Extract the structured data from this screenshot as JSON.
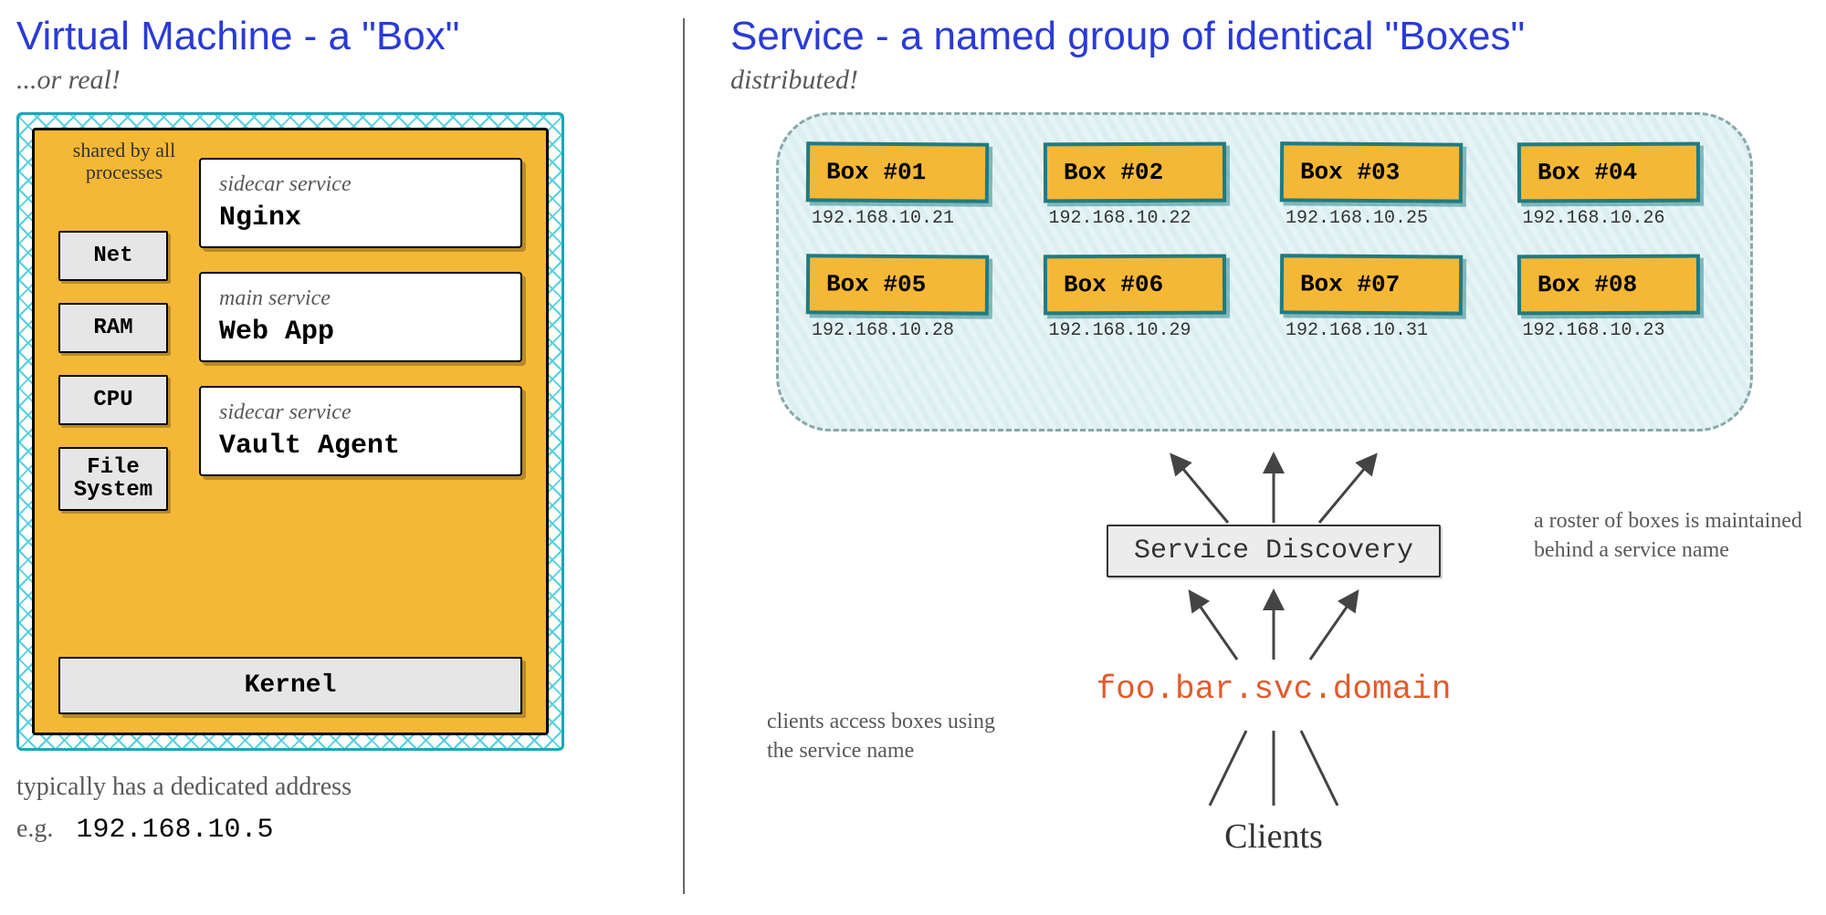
{
  "left": {
    "title": "Virtual Machine - a \"Box\"",
    "subtitle": "...or real!",
    "shared_label": "shared by all processes",
    "resources": [
      "Net",
      "RAM",
      "CPU",
      "File System"
    ],
    "services": [
      {
        "tag": "sidecar service",
        "name": "Nginx"
      },
      {
        "tag": "main service",
        "name": "Web App"
      },
      {
        "tag": "sidecar service",
        "name": "Vault Agent"
      }
    ],
    "kernel": "Kernel",
    "note": "typically has a dedicated address",
    "ip_label": "e.g.",
    "ip": "192.168.10.5"
  },
  "right": {
    "title": "Service - a named group of identical \"Boxes\"",
    "subtitle": "distributed!",
    "boxes": [
      {
        "label": "Box #01",
        "ip": "192.168.10.21"
      },
      {
        "label": "Box #02",
        "ip": "192.168.10.22"
      },
      {
        "label": "Box #03",
        "ip": "192.168.10.25"
      },
      {
        "label": "Box #04",
        "ip": "192.168.10.26"
      },
      {
        "label": "Box #05",
        "ip": "192.168.10.28"
      },
      {
        "label": "Box #06",
        "ip": "192.168.10.29"
      },
      {
        "label": "Box #07",
        "ip": "192.168.10.31"
      },
      {
        "label": "Box #08",
        "ip": "192.168.10.23"
      }
    ],
    "service_discovery": "Service Discovery",
    "svc_name": "foo.bar.svc.domain",
    "clients": "Clients",
    "roster_note": "a roster of boxes is maintained behind a service name",
    "client_note": "clients access boxes using the service name"
  }
}
